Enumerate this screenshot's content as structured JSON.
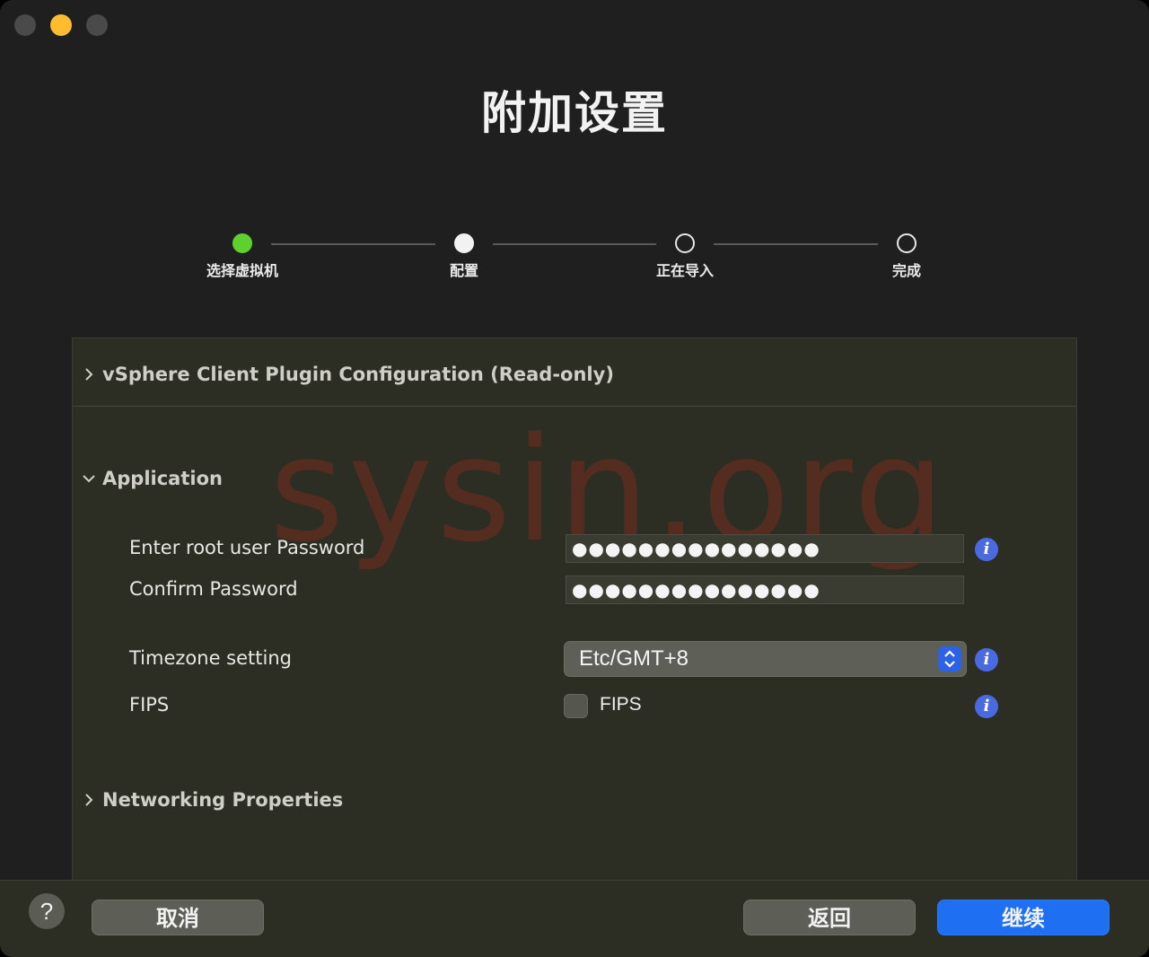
{
  "window": {
    "title": "附加设置"
  },
  "stepper": {
    "steps": [
      {
        "label": "选择虚拟机",
        "state": "done"
      },
      {
        "label": "配置",
        "state": "current"
      },
      {
        "label": "正在导入",
        "state": "pending"
      },
      {
        "label": "完成",
        "state": "pending"
      }
    ]
  },
  "sections": {
    "vsphere": {
      "label": "vSphere Client Plugin Configuration (Read-only)",
      "expanded": false
    },
    "application": {
      "label": "Application",
      "expanded": true
    },
    "networking": {
      "label": "Networking Properties",
      "expanded": false
    }
  },
  "application": {
    "root_password_label": "Enter root user Password",
    "root_password_value": "●●●●●●●●●●●●●●●",
    "confirm_password_label": "Confirm Password",
    "confirm_password_value": "●●●●●●●●●●●●●●●",
    "timezone_label": "Timezone setting",
    "timezone_value": "Etc/GMT+8",
    "fips_label": "FIPS",
    "fips_checkbox_label": "FIPS",
    "fips_checked": false
  },
  "watermark": "sysin.org",
  "footer": {
    "help": "?",
    "cancel": "取消",
    "back": "返回",
    "continue": "继续"
  },
  "colors": {
    "step_done": "#5ed12f",
    "primary_button": "#1f6ff2",
    "info_icon": "#4a6be0",
    "window_bg": "#1f1f1f",
    "panel_bg": "#2c2d23"
  }
}
